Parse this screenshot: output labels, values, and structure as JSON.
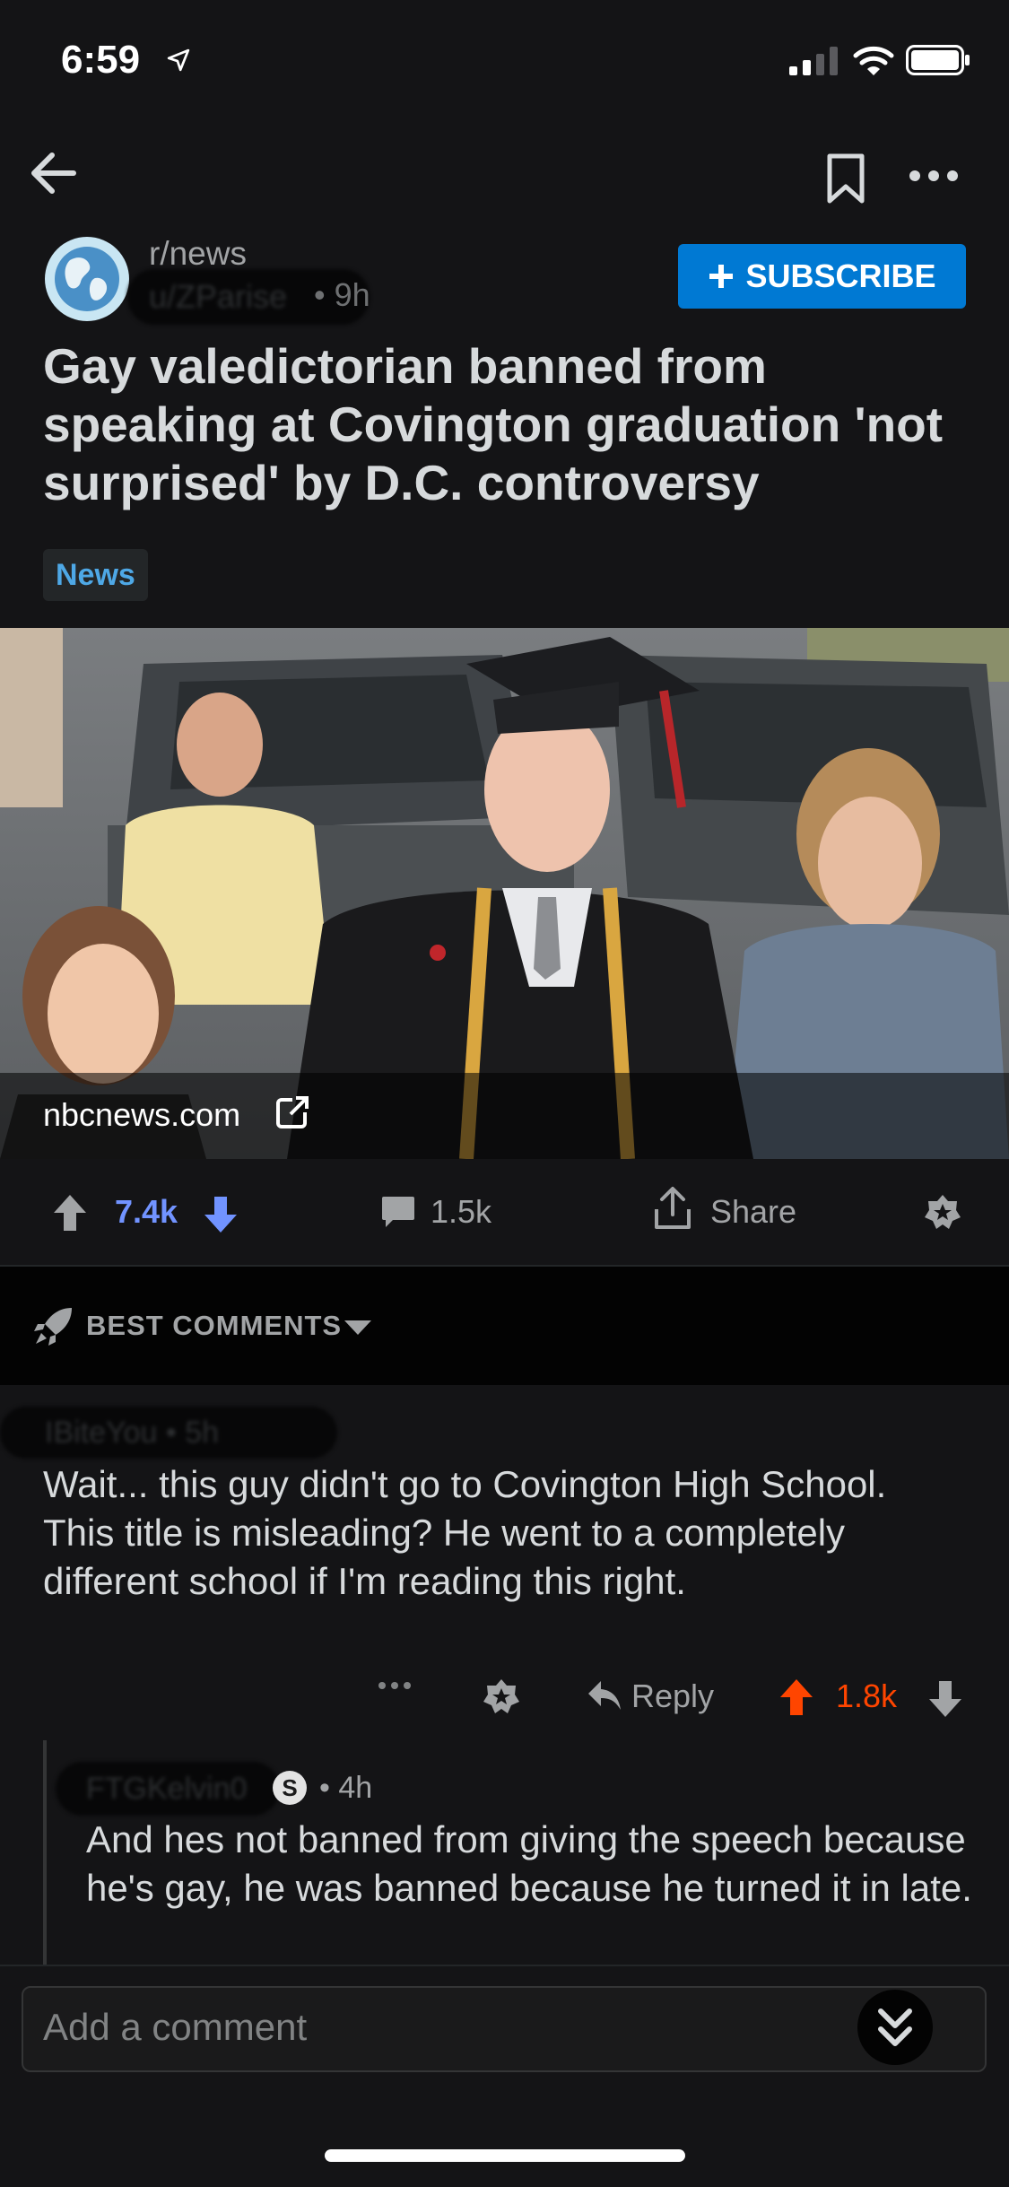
{
  "status_bar": {
    "time": "6:59"
  },
  "header": {
    "subreddit": "r/news",
    "author": "u/ZParise",
    "age": "• 9h",
    "subscribe_label": "SUBSCRIBE"
  },
  "post": {
    "title": "Gay valedictorian banned from speaking at Covington graduation 'not surprised' by D.C. controversy",
    "flair": "News",
    "link_domain": "nbcnews.com",
    "score": "7.4k",
    "comments": "1.5k",
    "share_label": "Share"
  },
  "sort": {
    "label": "BEST COMMENTS"
  },
  "comments": [
    {
      "author": "IBiteYou • 5h",
      "body": "Wait... this guy didn't go to Covington High School.  This title is misleading?  He went to a completely different school if I'm reading this right.",
      "reply_label": "Reply",
      "score": "1.8k"
    },
    {
      "author": "FTGKelvin0",
      "age": "• 4h",
      "body": "And hes not banned from giving the speech because he's gay, he was banned because he turned it in late."
    }
  ],
  "composer": {
    "placeholder": "Add a comment"
  },
  "colors": {
    "accent": "#0079d3",
    "upvote": "#ff4500",
    "downvote": "#7193ff",
    "background": "#141416"
  }
}
